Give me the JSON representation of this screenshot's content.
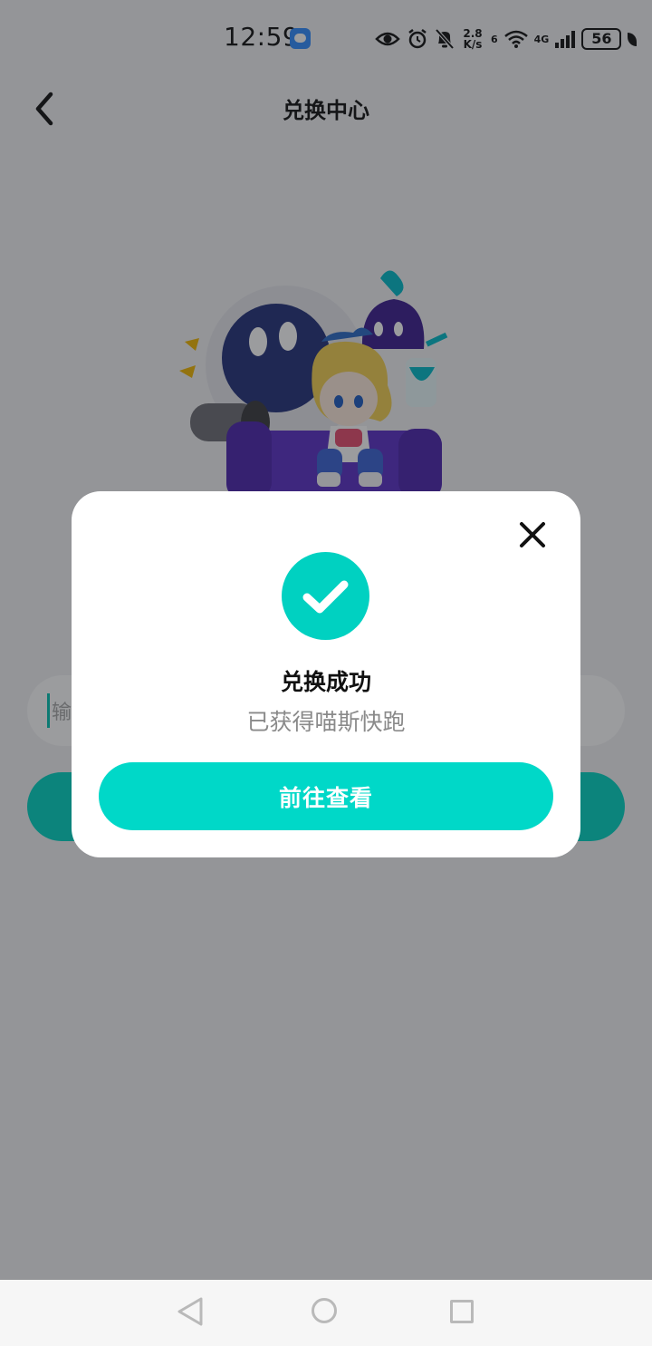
{
  "status_bar": {
    "time": "12:59",
    "net_speed_value": "2.8",
    "net_speed_unit": "K/s",
    "wifi_tag": "6",
    "cell_tag": "4G",
    "battery": "56"
  },
  "header": {
    "title": "兑换中心"
  },
  "redeem_form": {
    "input_placeholder": "输入",
    "input_value": ""
  },
  "dialog": {
    "title": "兑换成功",
    "message": "已获得喵斯快跑",
    "button_label": "前往查看"
  },
  "colors": {
    "accent": "#00d8c8",
    "overlay": "rgba(28,30,34,0.44)"
  },
  "icons": {
    "back": "chevron-left-icon",
    "close": "close-icon",
    "success": "check-circle-icon"
  }
}
